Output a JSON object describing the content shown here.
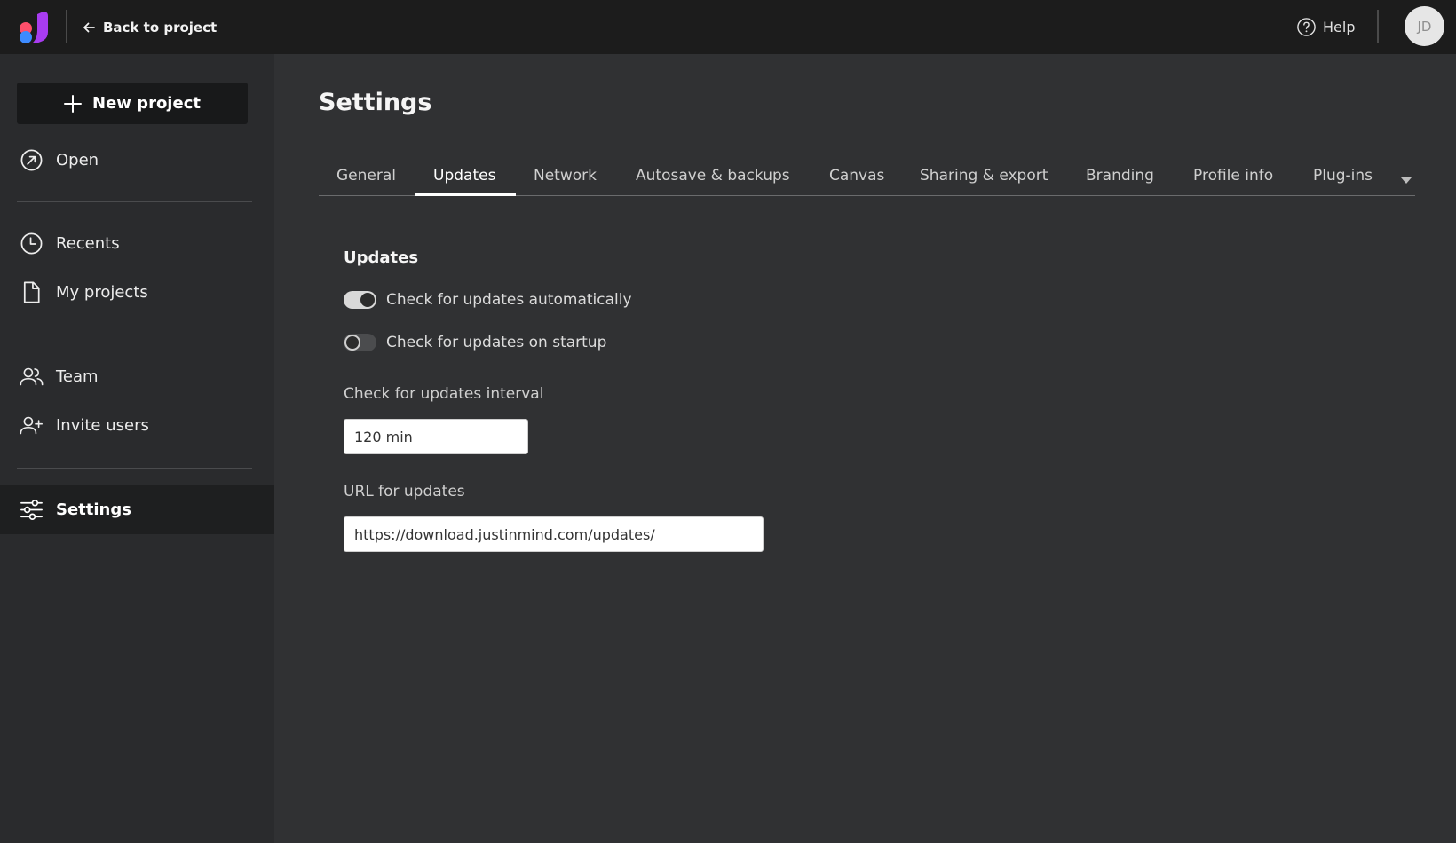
{
  "topbar": {
    "back_label": "Back to project",
    "help_label": "Help",
    "avatar_initials": "JD",
    "logo_colors": [
      "#ff4f6b",
      "#3d8bff",
      "#a83cf0"
    ]
  },
  "sidebar": {
    "new_project_label": "New project",
    "items": [
      {
        "label": "Open",
        "icon": "open-icon"
      },
      {
        "label": "Recents",
        "icon": "clock-icon"
      },
      {
        "label": "My projects",
        "icon": "file-icon"
      },
      {
        "label": "Team",
        "icon": "team-icon"
      },
      {
        "label": "Invite users",
        "icon": "add-user-icon"
      },
      {
        "label": "Settings",
        "icon": "sliders-icon",
        "active": true
      }
    ]
  },
  "main": {
    "title": "Settings",
    "tabs": [
      {
        "label": "General"
      },
      {
        "label": "Updates",
        "active": true
      },
      {
        "label": "Network"
      },
      {
        "label": "Autosave & backups"
      },
      {
        "label": "Canvas"
      },
      {
        "label": "Sharing & export"
      },
      {
        "label": "Branding"
      },
      {
        "label": "Profile info"
      },
      {
        "label": "Plug-ins"
      }
    ],
    "section_title": "Updates",
    "toggles": [
      {
        "label": "Check for updates automatically",
        "on": true
      },
      {
        "label": "Check for updates on startup",
        "on": false
      }
    ],
    "interval_label": "Check for updates interval",
    "interval_value": "120 min",
    "url_label": "URL for updates",
    "url_value": "https://download.justinmind.com/updates/"
  }
}
